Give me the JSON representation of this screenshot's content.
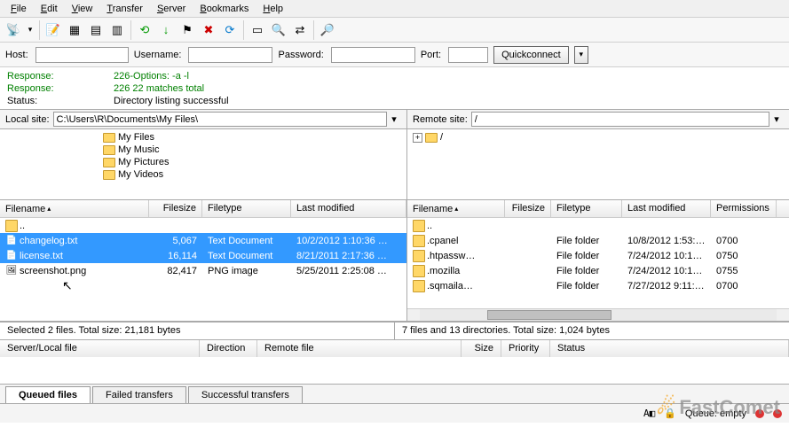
{
  "menu": [
    "File",
    "Edit",
    "View",
    "Transfer",
    "Server",
    "Bookmarks",
    "Help"
  ],
  "conn": {
    "host_label": "Host:",
    "user_label": "Username:",
    "pass_label": "Password:",
    "port_label": "Port:",
    "quickconnect": "Quickconnect"
  },
  "log": [
    {
      "label": "Response:",
      "text": "226-Options: -a -l",
      "green": true
    },
    {
      "label": "Response:",
      "text": "226 22 matches total",
      "green": true
    },
    {
      "label": "Status:",
      "text": "Directory listing successful",
      "green": false
    }
  ],
  "local": {
    "label": "Local site:",
    "path": "C:\\Users\\R\\Documents\\My Files\\",
    "tree": [
      "My Files",
      "My Music",
      "My Pictures",
      "My Videos"
    ],
    "cols": [
      "Filename",
      "Filesize",
      "Filetype",
      "Last modified"
    ],
    "rows": [
      {
        "ico": "up",
        "name": ".."
      },
      {
        "ico": "txt",
        "name": "changelog.txt",
        "size": "5,067",
        "type": "Text Document",
        "mod": "10/2/2012 1:10:36 …",
        "sel": true
      },
      {
        "ico": "txt",
        "name": "license.txt",
        "size": "16,114",
        "type": "Text Document",
        "mod": "8/21/2011 2:17:36 …",
        "sel": true
      },
      {
        "ico": "img",
        "name": "screenshot.png",
        "size": "82,417",
        "type": "PNG image",
        "mod": "5/25/2011 2:25:08 …"
      }
    ],
    "status": "Selected 2 files. Total size: 21,181 bytes"
  },
  "remote": {
    "label": "Remote site:",
    "path": "/",
    "tree_root": "/",
    "cols": [
      "Filename",
      "Filesize",
      "Filetype",
      "Last modified",
      "Permissions"
    ],
    "rows": [
      {
        "ico": "up",
        "name": ".."
      },
      {
        "ico": "dir",
        "name": ".cpanel",
        "size": "",
        "type": "File folder",
        "mod": "10/8/2012 1:53:…",
        "perm": "0700"
      },
      {
        "ico": "dir",
        "name": ".htpassw…",
        "size": "",
        "type": "File folder",
        "mod": "7/24/2012 10:1…",
        "perm": "0750"
      },
      {
        "ico": "dir",
        "name": ".mozilla",
        "size": "",
        "type": "File folder",
        "mod": "7/24/2012 10:1…",
        "perm": "0755"
      },
      {
        "ico": "dir",
        "name": ".sqmaila…",
        "size": "",
        "type": "File folder",
        "mod": "7/27/2012 9:11:…",
        "perm": "0700"
      }
    ],
    "status": "7 files and 13 directories. Total size: 1,024 bytes"
  },
  "queue": {
    "cols": [
      "Server/Local file",
      "Direction",
      "Remote file",
      "Size",
      "Priority",
      "Status"
    ],
    "tabs": [
      "Queued files",
      "Failed transfers",
      "Successful transfers"
    ]
  },
  "bottom": {
    "queue_label": "Queue: empty"
  },
  "watermark": "FastComet"
}
